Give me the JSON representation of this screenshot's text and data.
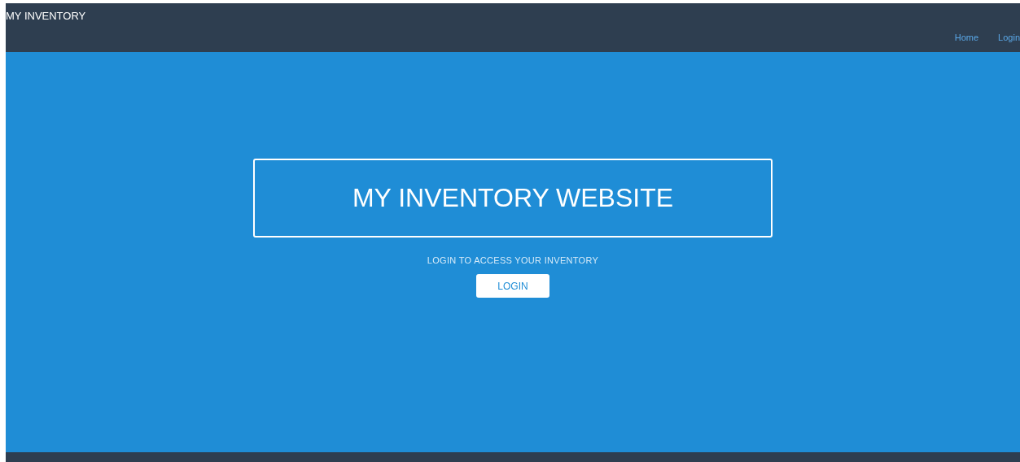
{
  "navbar": {
    "brand": "MY INVENTORY",
    "links": [
      {
        "label": "Home"
      },
      {
        "label": "Login"
      }
    ]
  },
  "hero": {
    "title": "MY INVENTORY WEBSITE",
    "subtitle": "LOGIN TO ACCESS YOUR INVENTORY",
    "button": "LOGIN"
  }
}
